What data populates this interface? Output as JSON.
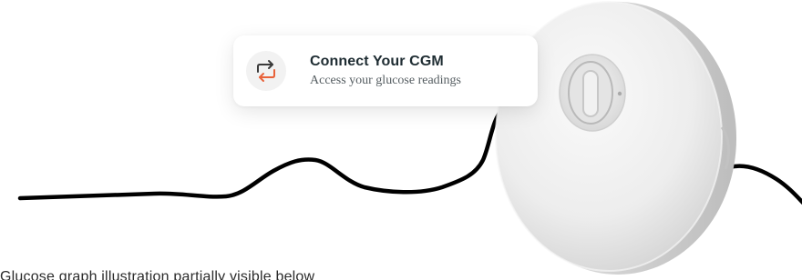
{
  "card": {
    "title": "Connect Your CGM",
    "subtitle": "Access your glucose readings",
    "icon": "swap-arrows-icon"
  },
  "footer_text": "Glucose graph illustration partially visible below",
  "colors": {
    "icon_top_arrow": "#3a3a3a",
    "icon_bottom_arrow": "#e8623a",
    "line": "#000000",
    "sensor_body": "#ececec"
  }
}
